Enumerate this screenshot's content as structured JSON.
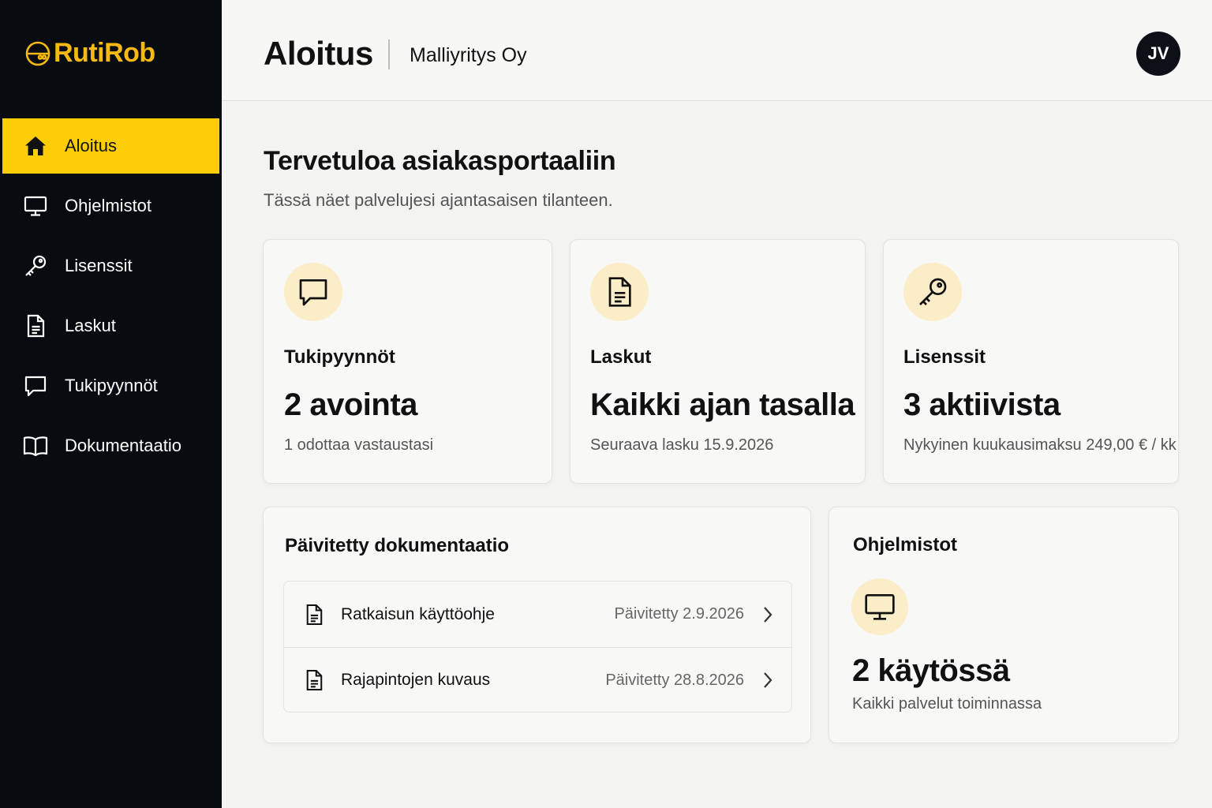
{
  "app": {
    "name": "RutiRob",
    "logo_icon": "robot-face-icon"
  },
  "sidebar": {
    "items": [
      {
        "label": "Aloitus",
        "icon": "home-icon",
        "active": true
      },
      {
        "label": "Ohjelmistot",
        "icon": "monitor-icon",
        "active": false
      },
      {
        "label": "Lisenssit",
        "icon": "key-icon",
        "active": false
      },
      {
        "label": "Laskut",
        "icon": "document-icon",
        "active": false
      },
      {
        "label": "Tukipyynnöt",
        "icon": "chat-bubble-icon",
        "active": false
      },
      {
        "label": "Dokumentaatio",
        "icon": "book-icon",
        "active": false
      }
    ]
  },
  "header": {
    "title": "Aloitus",
    "company": "Malliyritys Oy",
    "avatar_initials": "JV"
  },
  "main": {
    "welcome_title": "Tervetuloa asiakasportaaliin",
    "welcome_subtitle": "Tässä näet palvelujesi ajantasaisen tilanteen.",
    "cards": [
      {
        "icon": "chat-bubble-icon",
        "label": "Tukipyynnöt",
        "value": "2 avointa",
        "note": "1 odottaa vastaustasi"
      },
      {
        "icon": "document-icon",
        "label": "Laskut",
        "value": "Kaikki ajan tasalla",
        "note": "Seuraava lasku 15.9.2026"
      },
      {
        "icon": "key-icon",
        "label": "Lisenssit",
        "value": "3 aktiivista",
        "note": "Nykyinen kuukausimaksu 249,00 € / kk"
      }
    ],
    "docs": {
      "title": "Päivitetty dokumentaatio",
      "items": [
        {
          "title": "Ratkaisun käyttöohje",
          "date": "Päivitetty 2.9.2026",
          "icon": "document-icon"
        },
        {
          "title": "Rajapintojen kuvaus",
          "date": "Päivitetty 28.8.2026",
          "icon": "document-icon"
        }
      ]
    },
    "software": {
      "title": "Ohjelmistot",
      "icon": "monitor-icon",
      "value": "2 käytössä",
      "note": "Kaikki palvelut toiminnassa"
    }
  },
  "colors": {
    "accent": "#fdcd05",
    "logo": "#f5b90f",
    "sidebar_bg": "#080b10",
    "icon_circle": "#fbedc7"
  }
}
